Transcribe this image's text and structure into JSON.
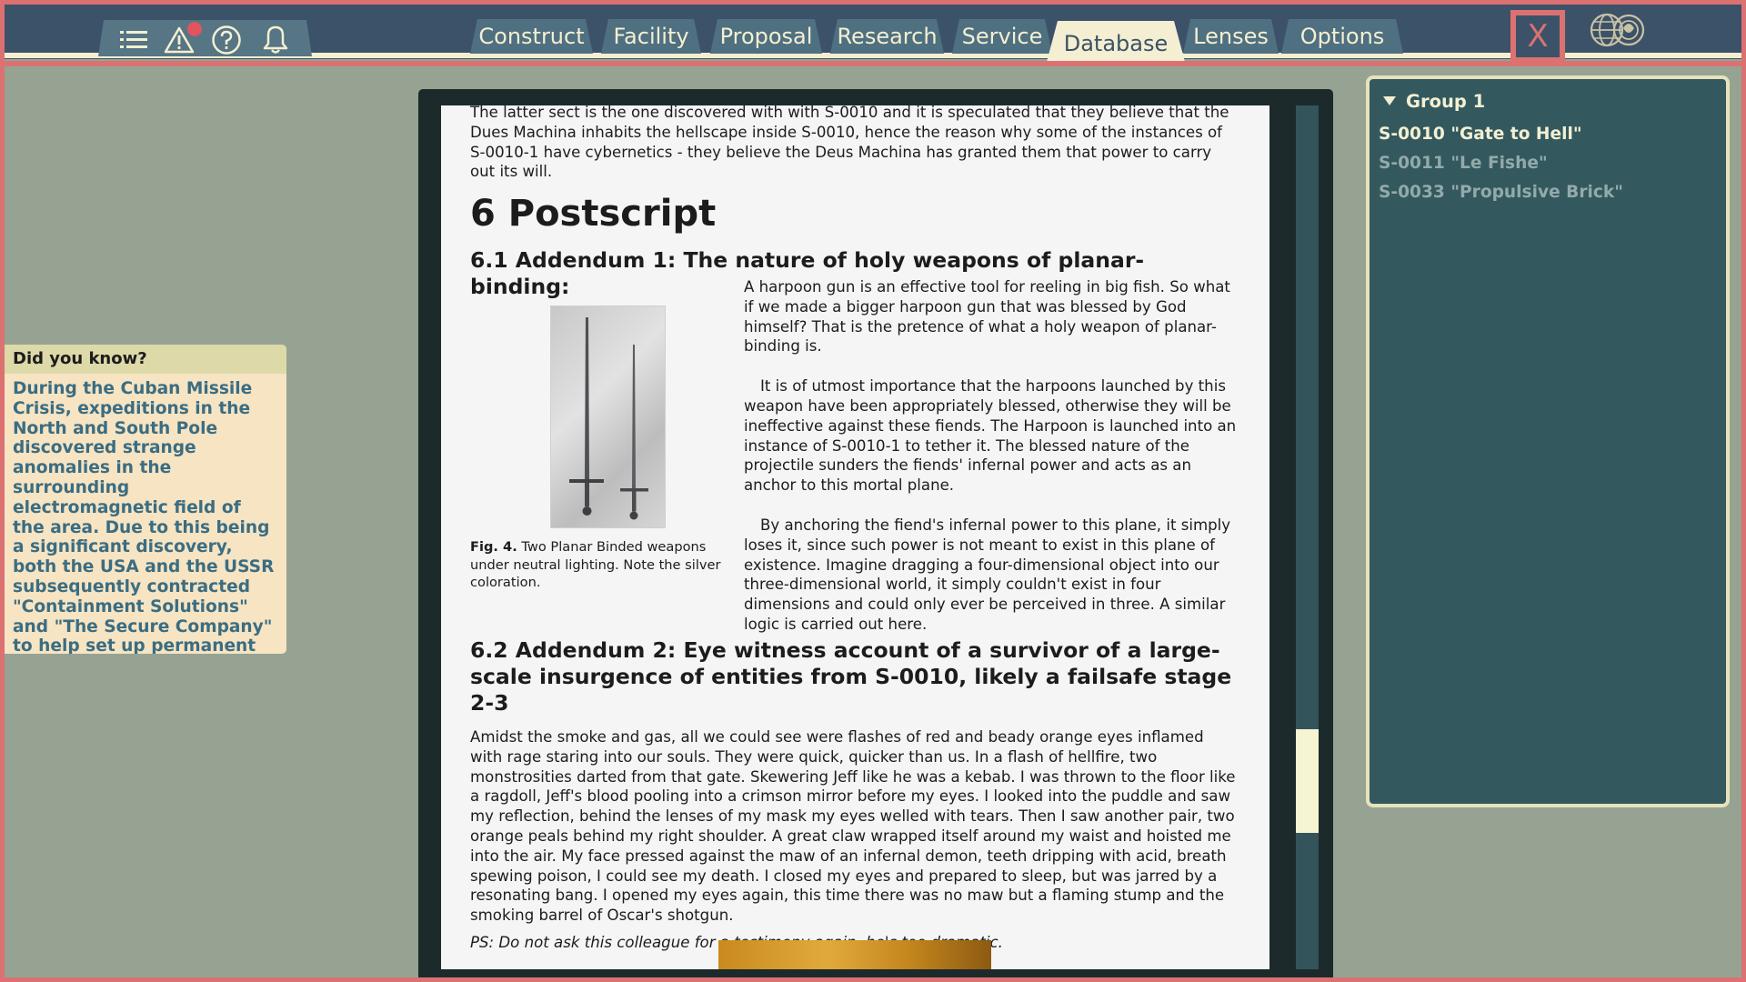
{
  "colors": {
    "frame_border": "#dc7172",
    "background": "#96a392",
    "topbar": "#3c5268",
    "tab": "#4f7080",
    "tab_active": "#f4efd2",
    "panel": "#33595f",
    "accent_text": "#3b6d82"
  },
  "topbar": {
    "icons": [
      "menu-icon",
      "warning-icon",
      "help-icon",
      "bell-icon"
    ],
    "tabs": [
      {
        "label": "Construct",
        "active": false
      },
      {
        "label": "Facility",
        "active": false
      },
      {
        "label": "Proposal",
        "active": false
      },
      {
        "label": "Research",
        "active": false
      },
      {
        "label": "Service",
        "active": false
      },
      {
        "label": "Database",
        "active": true
      },
      {
        "label": "Lenses",
        "active": false
      },
      {
        "label": "Options",
        "active": false
      }
    ],
    "close_label": "X"
  },
  "did_you_know": {
    "title": "Did you know?",
    "body": "During the Cuban Missile Crisis, expeditions in the North and South Pole discovered strange anomalies in the surrounding electromagnetic field of the area. Due to this being a significant discovery, both the USA and the USSR subsequently contracted \"Containment Solutions\" and \"The Secure Company\" to help set up permanent bases in the area."
  },
  "document": {
    "intro": "The latter sect is the one discovered with with S-0010 and it is speculated that they believe that the Dues Machina inhabits the hellscape inside S-0010, hence the reason why some of the instances of S-0010-1 have cybernetics - they believe the Deus Machina has granted them that power to carry out its will.",
    "section_heading": "6 Postscript",
    "addendum1_heading": "6.1 Addendum 1: The nature of holy weapons of planar-binding:",
    "addendum1_paragraphs": [
      "A harpoon gun is an effective tool for reeling in big fish. So what if we made a bigger harpoon gun that was blessed by God himself? That is the pretence of what a holy weapon of planar-binding is.",
      "It is of utmost importance that the harpoons launched by this weapon have been appropriately blessed, otherwise they will be ineffective against these fiends. The Harpoon is launched into an instance of S-0010-1 to tether it. The blessed nature of the projectile sunders the fiends' infernal power and acts as an anchor to this mortal plane.",
      "By anchoring the fiend's infernal power to this plane, it simply loses it, since such power is not meant to exist in this plane of existence. Imagine dragging a four-dimensional object into our three-dimensional world, it simply couldn't exist in four dimensions and could only ever be perceived in three. A similar logic is carried out here."
    ],
    "figure_label": "Fig. 4.",
    "figure_caption": "Two Planar Binded weapons under neutral lighting. Note the silver coloration.",
    "addendum2_heading": "6.2 Addendum 2: Eye witness account of a survivor of a large-scale insurgence of entities from S-0010, likely a failsafe stage 2-3",
    "addendum2_text": "Amidst the smoke and gas, all we could see were flashes of red and beady orange eyes inflamed with rage staring into our souls. They were quick, quicker than us. In a flash of hellfire, two monstrosities darted from that gate. Skewering Jeff like he was a kebab. I was thrown to the floor like a ragdoll, Jeff's blood pooling into a crimson mirror before my eyes. I looked into the puddle and saw my reflection, behind the lenses of my mask my eyes welled with tears. Then I saw another pair, two orange peals behind my right shoulder. A great claw wrapped itself around my waist and hoisted me into the air. My face pressed against the maw of an infernal demon, teeth dripping with acid, breath spewing poison, I could see my death. I closed my eyes and prepared to sleep, but was jarred by a resonating bang. I opened my eyes again, this time there was no maw but a flaming stump and the smoking barrel of Oscar's shotgun.",
    "postscript_note": "PS: Do not ask this colleague for a testimony again, he's too dramatic.",
    "scroll_position": 0.82,
    "scroll_visible_fraction": 0.12
  },
  "group_panel": {
    "title": "Group 1",
    "items": [
      {
        "label": "S-0010 \"Gate to Hell\"",
        "selected": true
      },
      {
        "label": "S-0011 \"Le Fishe\"",
        "selected": false
      },
      {
        "label": "S-0033 \"Propulsive Brick\"",
        "selected": false
      }
    ]
  }
}
